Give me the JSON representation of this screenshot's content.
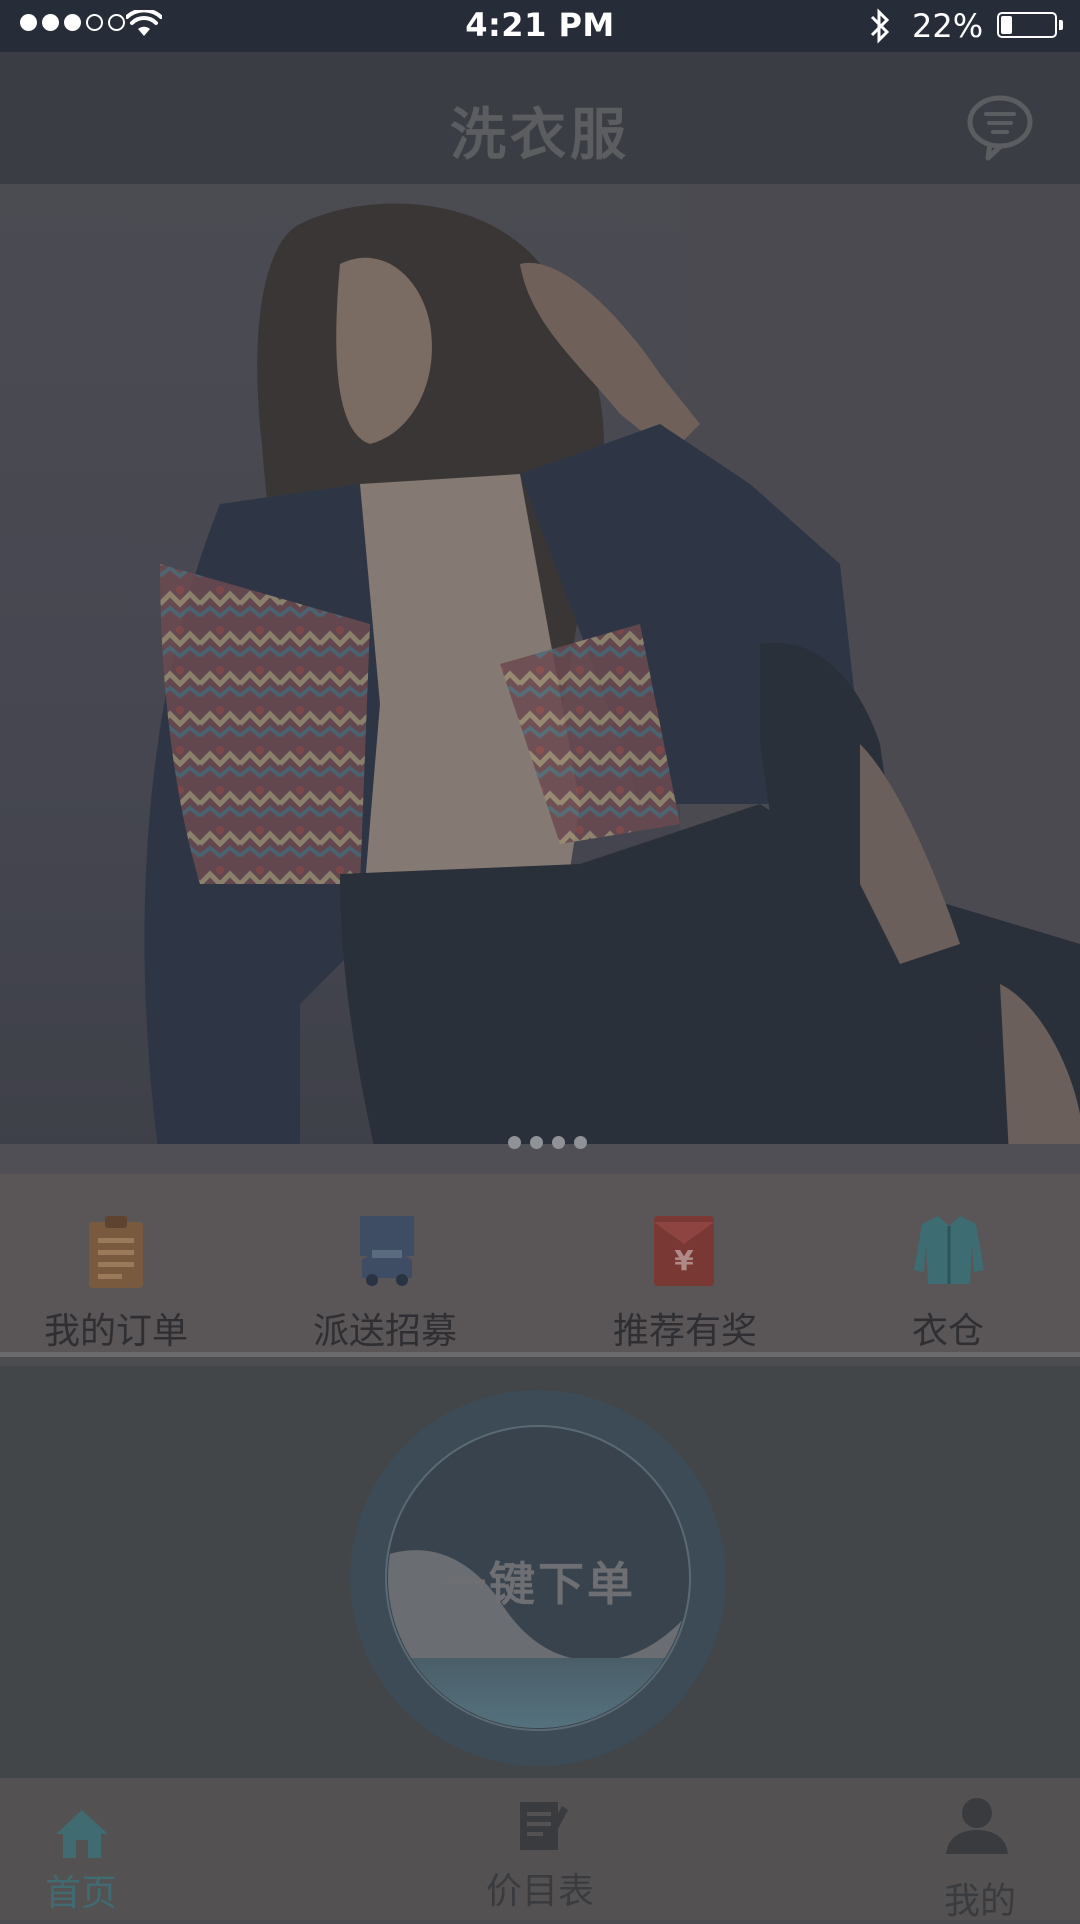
{
  "status_bar": {
    "time": "4:21 PM",
    "battery_percent": "22%",
    "battery_level": 0.22,
    "signal_bars_filled": 3,
    "signal_bars_total": 5,
    "icons": [
      "signal-icon",
      "wifi-icon",
      "bluetooth-icon",
      "battery-icon"
    ]
  },
  "header": {
    "title": "洗衣服",
    "message_icon": "chat-bubble-icon"
  },
  "banner": {
    "page_count": 4,
    "current_page": 1
  },
  "quick_menu": [
    {
      "label": "我的订单",
      "icon": "clipboard-icon",
      "color": "#7a5a3e"
    },
    {
      "label": "派送招募",
      "icon": "delivery-truck-icon",
      "color": "#3e4d63"
    },
    {
      "label": "推荐有奖",
      "icon": "red-envelope-icon",
      "color": "#7a3834"
    },
    {
      "label": "衣仓",
      "icon": "jacket-icon",
      "color": "#3d6c73"
    }
  ],
  "order": {
    "label": "一键下单"
  },
  "tab_bar": [
    {
      "label": "首页",
      "icon": "home-icon",
      "active": true
    },
    {
      "label": "价目表",
      "icon": "price-list-icon",
      "active": false
    },
    {
      "label": "我的",
      "icon": "profile-icon",
      "active": false
    }
  ],
  "colors": {
    "status_bar_bg": "#262d39",
    "nav_bg": "#3a3e44",
    "tab_active": "#3f6b71",
    "tab_inactive": "#3a3b3e"
  }
}
